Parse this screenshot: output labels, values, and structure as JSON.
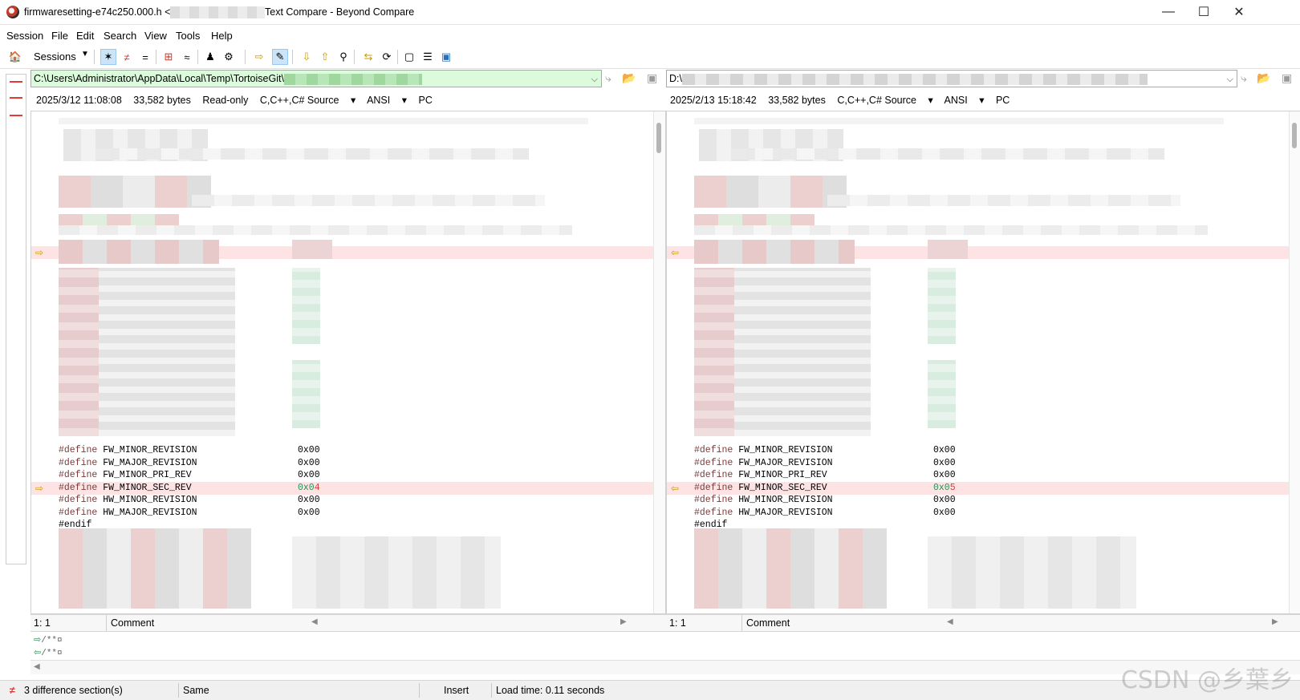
{
  "window": {
    "title_left": "firmwaresetting-e74c250.000.h <-",
    "title_right": "Text Compare - Beyond Compare",
    "minimize": "—",
    "maximize": "☐",
    "close": "✕"
  },
  "menu": [
    "Session",
    "File",
    "Edit",
    "Search",
    "View",
    "Tools",
    "Help"
  ],
  "toolbar": {
    "sessions_label": "Sessions"
  },
  "left": {
    "path": "C:\\Users\\Administrator\\AppData\\Local\\Temp\\TortoiseGit\\",
    "date": "2025/3/12 11:08:08",
    "size": "33,582 bytes",
    "readonly": "Read-only",
    "format": "C,C++,C# Source",
    "encoding": "ANSI",
    "lineend": "PC",
    "cursor": "1: 1",
    "status_comment": "Comment",
    "sec_rev_value": "0x04"
  },
  "right": {
    "path": "D:\\",
    "date": "2025/2/13 15:18:42",
    "size": "33,582 bytes",
    "format": "C,C++,C# Source",
    "encoding": "ANSI",
    "lineend": "PC",
    "cursor": "1: 1",
    "status_comment": "Comment",
    "sec_rev_value": "0x05"
  },
  "code": {
    "define_kw": "#define",
    "endif_kw": "#endif",
    "lines": [
      {
        "name": "FW_MINOR_REVISION",
        "value": "0x00"
      },
      {
        "name": "FW_MAJOR_REVISION",
        "value": "0x00"
      },
      {
        "name": "FW_MINOR_PRI_REV",
        "value": "0x00"
      },
      {
        "name": "FW_MINOR_SEC_REV",
        "value": "0x0"
      },
      {
        "name": "HW_MINOR_REVISION",
        "value": "0x00"
      },
      {
        "name": "HW_MAJOR_REVISION",
        "value": "0x00"
      }
    ]
  },
  "detail": {
    "line1": "/**¤",
    "line2": "/**¤"
  },
  "statusbar": {
    "differences": "3 difference section(s)",
    "same": "Same",
    "mode": "Insert",
    "load_time": "Load time: 0.11 seconds"
  },
  "watermark": "CSDN @乡葉乡"
}
